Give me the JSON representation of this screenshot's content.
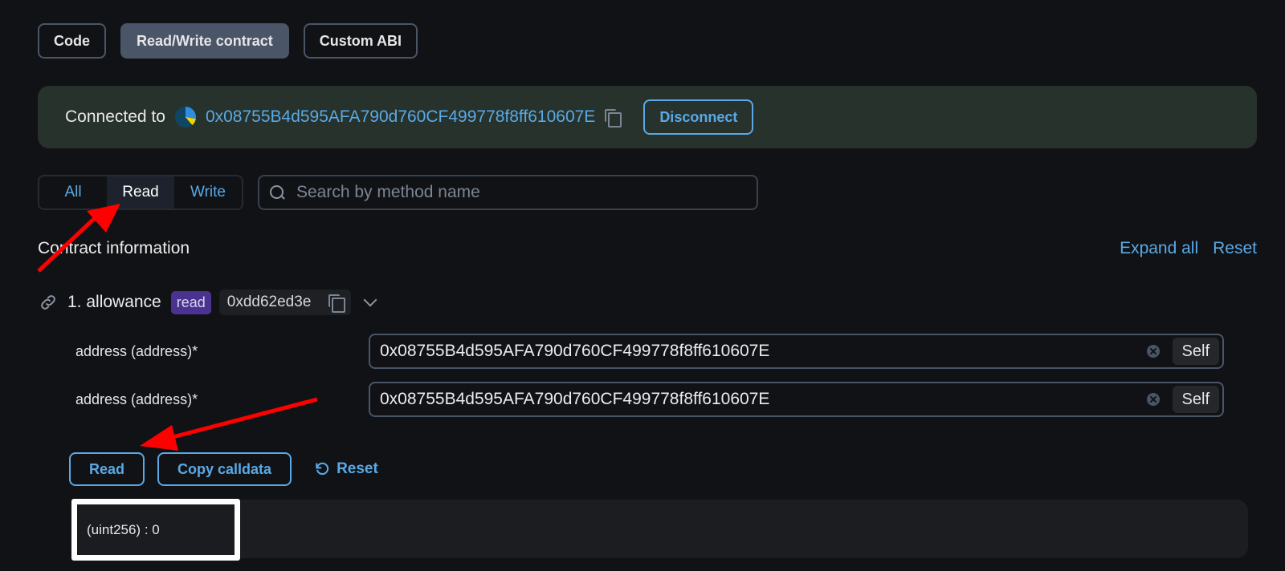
{
  "top_tabs": [
    {
      "label": "Code",
      "active": false
    },
    {
      "label": "Read/Write contract",
      "active": true
    },
    {
      "label": "Custom ABI",
      "active": false
    }
  ],
  "connection": {
    "label": "Connected to",
    "address": "0x08755B4d595AFA790d760CF499778f8ff610607E",
    "copy_icon": "copy-icon",
    "disconnect_label": "Disconnect"
  },
  "filter": {
    "tabs": [
      {
        "label": "All",
        "active": false
      },
      {
        "label": "Read",
        "active": true
      },
      {
        "label": "Write",
        "active": false
      }
    ],
    "search_placeholder": "Search by method name",
    "search_value": ""
  },
  "section": {
    "title": "Contract information",
    "expand_all": "Expand all",
    "reset": "Reset"
  },
  "method": {
    "name": "1. allowance",
    "badge": "read",
    "selector": "0xdd62ed3e",
    "args": [
      {
        "label": "address (address)*",
        "value": "0x08755B4d595AFA790d760CF499778f8ff610607E",
        "self_label": "Self"
      },
      {
        "label": "address (address)*",
        "value": "0x08755B4d595AFA790d760CF499778f8ff610607E",
        "self_label": "Self"
      }
    ],
    "read_label": "Read",
    "copy_calldata_label": "Copy calldata",
    "reset_label": "Reset",
    "result": "(uint256) : 0"
  },
  "colors": {
    "accent": "#5aa9e6",
    "background": "#111215",
    "banner": "#27322c",
    "badge_read": "#4a3390",
    "annotation_arrow": "#ff0000"
  }
}
